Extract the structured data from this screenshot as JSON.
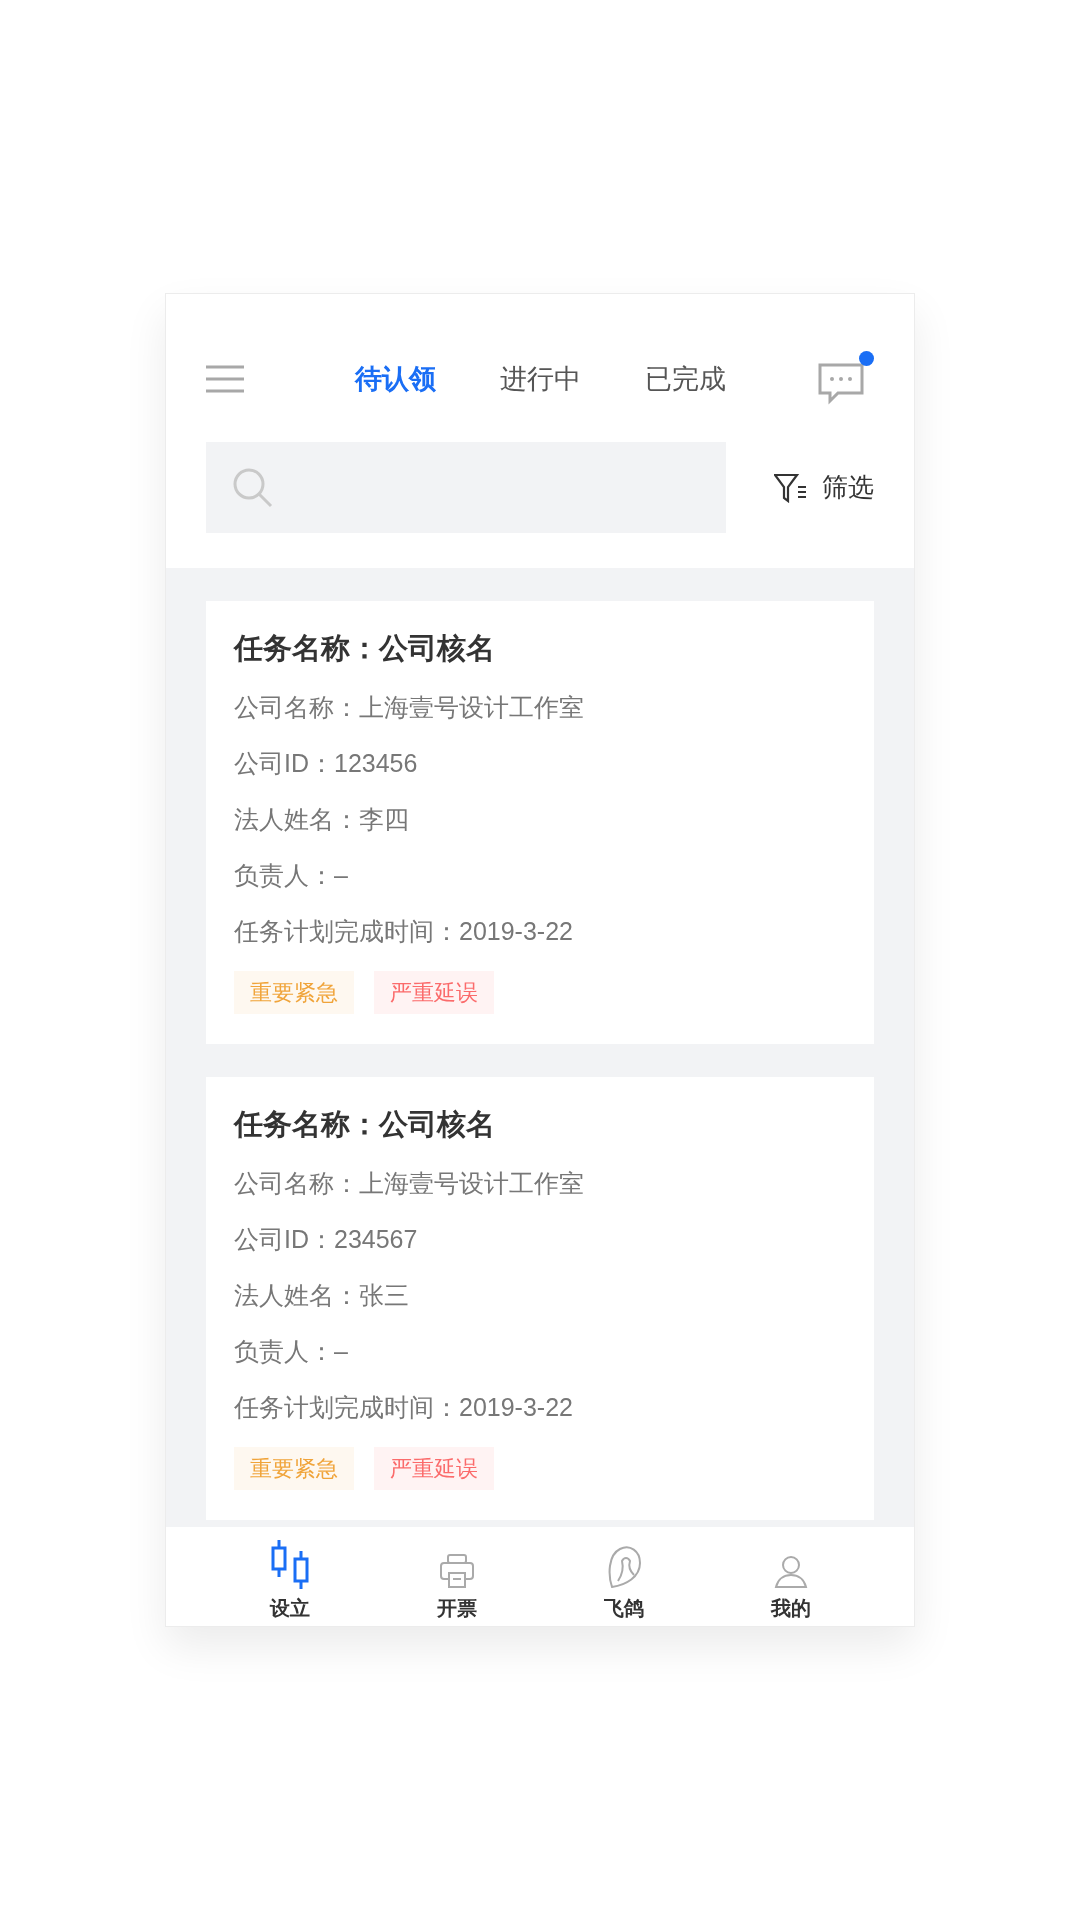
{
  "tabs": [
    {
      "label": "待认领",
      "selected": true
    },
    {
      "label": "进行中",
      "selected": false
    },
    {
      "label": "已完成",
      "selected": false
    }
  ],
  "messages": {
    "unread": true
  },
  "filter": {
    "label": "筛选"
  },
  "tasks": [
    {
      "title": "任务名称：公司核名",
      "fields": [
        "公司名称：上海壹号设计工作室",
        "公司ID：123456",
        "法人姓名：李四",
        "负责人：–",
        "任务计划完成时间：2019-3-22"
      ],
      "tags": [
        {
          "label": "重要紧急",
          "color": "#f0a43a"
        },
        {
          "label": "严重延误",
          "color": "#fb6b6b"
        }
      ]
    },
    {
      "title": "任务名称：公司核名",
      "fields": [
        "公司名称：上海壹号设计工作室",
        "公司ID：234567",
        "法人姓名：张三",
        "负责人：–",
        "任务计划完成时间：2019-3-22"
      ],
      "tags": [
        {
          "label": "重要紧急",
          "color": "#f0a43a"
        },
        {
          "label": "严重延误",
          "color": "#fb6b6b"
        }
      ]
    }
  ],
  "nav": [
    {
      "label": "设立",
      "kind": "candles",
      "selected": true
    },
    {
      "label": "开票",
      "kind": "printer",
      "selected": false
    },
    {
      "label": "飞鸽",
      "kind": "bird",
      "selected": false
    },
    {
      "label": "我的",
      "kind": "person",
      "selected": false
    }
  ]
}
